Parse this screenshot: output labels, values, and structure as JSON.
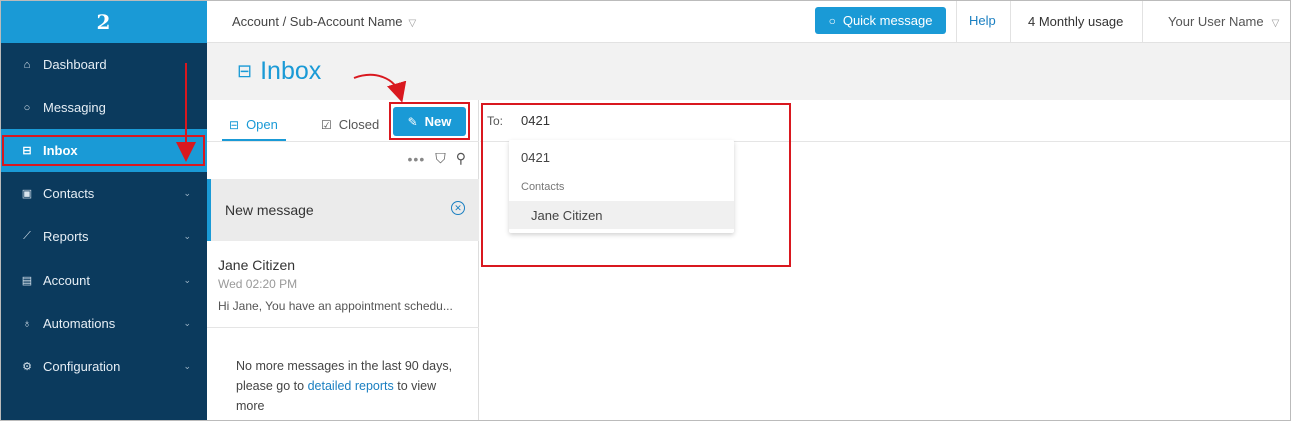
{
  "brand": {
    "logo_text": "2"
  },
  "sidebar": {
    "items": [
      {
        "label": "Dashboard",
        "icon": "home-icon",
        "has_chevron": false
      },
      {
        "label": "Messaging",
        "icon": "chat-bubble-icon",
        "has_chevron": true
      },
      {
        "label": "Inbox",
        "icon": "inbox-icon",
        "has_chevron": false,
        "active": true
      },
      {
        "label": "Contacts",
        "icon": "contacts-icon",
        "has_chevron": true
      },
      {
        "label": "Reports",
        "icon": "chart-icon",
        "has_chevron": true
      },
      {
        "label": "Account",
        "icon": "account-icon",
        "has_chevron": true
      },
      {
        "label": "Automations",
        "icon": "automation-icon",
        "has_chevron": true
      },
      {
        "label": "Configuration",
        "icon": "gear-icon",
        "has_chevron": true
      }
    ]
  },
  "topbar": {
    "account": "Account / Sub-Account Name",
    "quick_message": "Quick message",
    "help": "Help",
    "usage": "4 Monthly usage",
    "user": "Your User Name"
  },
  "page": {
    "title": "Inbox"
  },
  "tabs": {
    "open": "Open",
    "closed": "Closed",
    "new": "New"
  },
  "conversations": {
    "draft": {
      "title": "New message"
    },
    "items": [
      {
        "name": "Jane Citizen",
        "time": "Wed 02:20 PM",
        "preview": "Hi Jane, You have an appointment schedu..."
      }
    ],
    "footer": {
      "text_before": "No more messages in the last 90 days, please go to ",
      "link": "detailed reports",
      "text_after": " to view more"
    }
  },
  "compose": {
    "to_label": "To:",
    "to_value": "0421",
    "dropdown": {
      "number": "0421",
      "section_heading": "Contacts",
      "contact": "Jane Citizen"
    }
  },
  "colors": {
    "sidebar_bg": "#0b3a5d",
    "accent": "#1a9ad6",
    "annotation_red": "#d9181f"
  }
}
